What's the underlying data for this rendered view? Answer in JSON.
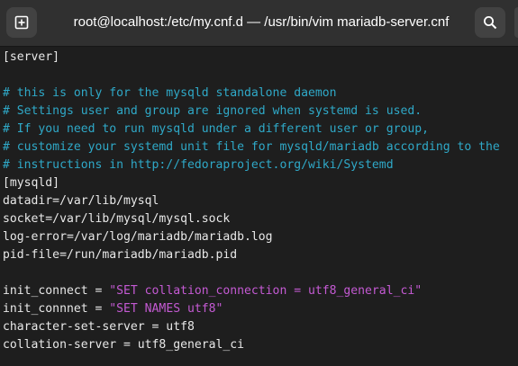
{
  "window": {
    "title": "root@localhost:/etc/my.cnf.d — /usr/bin/vim mariadb-server.cnf",
    "buttons": {
      "new_tab_icon": "new-tab-icon",
      "search_icon": "search-icon"
    }
  },
  "colors": {
    "text": "#e8e8e8",
    "comment": "#2fa9c8",
    "string": "#c45ad3",
    "background": "#1e1e1e",
    "titlebar": "#303030"
  },
  "editor": {
    "lines": {
      "l0": "[server]",
      "l1": "",
      "l2": "# this is only for the mysqld standalone daemon",
      "l3": "# Settings user and group are ignored when systemd is used.",
      "l4": "# If you need to run mysqld under a different user or group,",
      "l5": "# customize your systemd unit file for mysqld/mariadb according to the",
      "l6": "# instructions in http://fedoraproject.org/wiki/Systemd",
      "l7": "[mysqld]",
      "l8": "datadir=/var/lib/mysql",
      "l9": "socket=/var/lib/mysql/mysql.sock",
      "l10": "log-error=/var/log/mariadb/mariadb.log",
      "l11": "pid-file=/run/mariadb/mariadb.pid",
      "l12": "",
      "l13_key": "init_connect = ",
      "l13_val": "\"SET collation_connection = utf8_general_ci\"",
      "l14_key": "init_connnet = ",
      "l14_val": "\"SET NAMES utf8\"",
      "l15": "character-set-server = utf8",
      "l16": "collation-server = utf8_general_ci"
    }
  }
}
